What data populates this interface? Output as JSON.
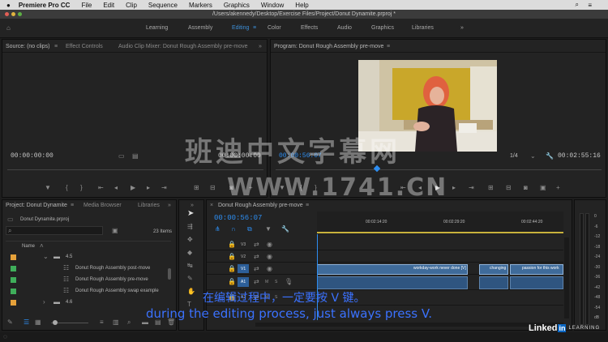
{
  "menubar": {
    "app_name": "Premiere Pro CC",
    "items": [
      "File",
      "Edit",
      "Clip",
      "Sequence",
      "Markers",
      "Graphics",
      "Window",
      "Help"
    ]
  },
  "window": {
    "path": "/Users/akennedy/Desktop/Exercise Files/Project/Donut Dynamite.prproj *"
  },
  "workspaces": [
    "Learning",
    "Assembly",
    "Editing",
    "Color",
    "Effects",
    "Audio",
    "Graphics",
    "Libraries"
  ],
  "source_panel": {
    "tabs": [
      "Source: (no clips)",
      "Effect Controls",
      "Audio Clip Mixer: Donut Rough Assembly pre-move"
    ],
    "timecode_left": "00:00:00:00",
    "timecode_right": "00:00:00:00"
  },
  "program_panel": {
    "tab": "Program: Donut Rough Assembly pre-move",
    "timecode": "00:00:56:07",
    "zoom": "1/4",
    "duration": "00:02:55:16"
  },
  "project_panel": {
    "tabs": [
      "Project: Donut Dynamite",
      "Media Browser",
      "Libraries"
    ],
    "file": "Donut Dynamite.prproj",
    "items_count": "23 Items",
    "column_name": "Name",
    "folders": [
      "4.5",
      "4.6"
    ],
    "items": [
      "Donut Rough Assembly post-move",
      "Donut Rough Assembly pre-move",
      "Donut Rough Assembly swap example"
    ],
    "colors": {
      "folder": "#e5a13a",
      "sequence": "#3fae5a"
    }
  },
  "timeline": {
    "tab": "Donut Rough Assembly pre-move",
    "timecode": "00:00:56:07",
    "ruler": [
      "00:02:14:20",
      "00:02:29:20",
      "00:02:44:20"
    ],
    "tracks": [
      "V3",
      "V2",
      "V1",
      "A1",
      "A2"
    ],
    "clips": [
      "workday-work never done [V]",
      "changing",
      "passion for this work"
    ]
  },
  "meter_scale": [
    "0",
    "-6",
    "-12",
    "-18",
    "-24",
    "-30",
    "-36",
    "-42",
    "-48",
    "-54",
    "dB"
  ],
  "watermark": {
    "chinese": "班迪中文字幕网",
    "url": "WWW.1741.CN"
  },
  "subtitles": {
    "chinese": "在编辑过程中，一定要按 V 键。",
    "english": "during the editing process, just always press V."
  },
  "branding": {
    "linkedin": "Linked",
    "in": "in",
    "learning": "LEARNING"
  }
}
